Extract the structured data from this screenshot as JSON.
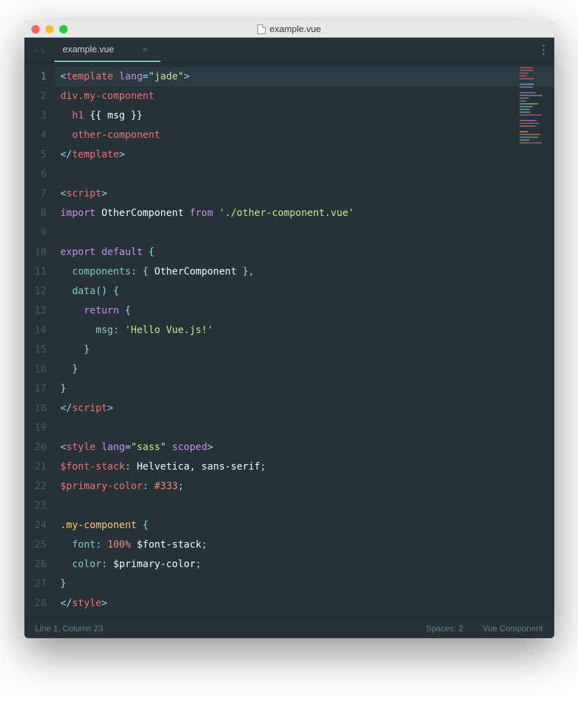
{
  "titlebar": {
    "filename": "example.vue"
  },
  "tabs": {
    "active": {
      "label": "example.vue"
    }
  },
  "gutter": {
    "lines": [
      "1",
      "2",
      "3",
      "4",
      "5",
      "6",
      "7",
      "8",
      "9",
      "10",
      "11",
      "12",
      "13",
      "14",
      "15",
      "16",
      "17",
      "18",
      "19",
      "20",
      "21",
      "22",
      "23",
      "24",
      "25",
      "26",
      "27",
      "28"
    ],
    "active_line": 1
  },
  "code": {
    "lines": [
      [
        {
          "t": "<",
          "c": "c-punct"
        },
        {
          "t": "template",
          "c": "c-tag"
        },
        {
          "t": " lang",
          "c": "c-attr"
        },
        {
          "t": "=",
          "c": "c-punct"
        },
        {
          "t": "\"jade\"",
          "c": "c-str"
        },
        {
          "t": ">",
          "c": "c-punct"
        }
      ],
      [
        {
          "t": "div.my-component",
          "c": "c-tag"
        }
      ],
      [
        {
          "t": "  h1",
          "c": "c-tag"
        },
        {
          "t": " {{ msg }}",
          "c": "c-plain"
        }
      ],
      [
        {
          "t": "  other-component",
          "c": "c-tag"
        }
      ],
      [
        {
          "t": "</",
          "c": "c-punct"
        },
        {
          "t": "template",
          "c": "c-tag"
        },
        {
          "t": ">",
          "c": "c-punct"
        }
      ],
      [],
      [
        {
          "t": "<",
          "c": "c-punct"
        },
        {
          "t": "script",
          "c": "c-tag"
        },
        {
          "t": ">",
          "c": "c-punct"
        }
      ],
      [
        {
          "t": "import",
          "c": "c-kw"
        },
        {
          "t": " OtherComponent ",
          "c": "c-plain"
        },
        {
          "t": "from",
          "c": "c-kw"
        },
        {
          "t": " './other-component.vue'",
          "c": "c-str"
        }
      ],
      [],
      [
        {
          "t": "export default",
          "c": "c-kw"
        },
        {
          "t": " {",
          "c": "c-punct"
        }
      ],
      [
        {
          "t": "  components",
          "c": "c-prop"
        },
        {
          "t": ":",
          "c": "c-punct"
        },
        {
          "t": " { ",
          "c": "c-punct"
        },
        {
          "t": "OtherComponent",
          "c": "c-plain"
        },
        {
          "t": " },",
          "c": "c-punct"
        }
      ],
      [
        {
          "t": "  data",
          "c": "c-prop"
        },
        {
          "t": "() {",
          "c": "c-punct"
        }
      ],
      [
        {
          "t": "    return",
          "c": "c-kw"
        },
        {
          "t": " {",
          "c": "c-punct"
        }
      ],
      [
        {
          "t": "      msg",
          "c": "c-prop"
        },
        {
          "t": ":",
          "c": "c-punct"
        },
        {
          "t": " 'Hello Vue.js!'",
          "c": "c-str"
        }
      ],
      [
        {
          "t": "    }",
          "c": "c-punct"
        }
      ],
      [
        {
          "t": "  }",
          "c": "c-punct"
        }
      ],
      [
        {
          "t": "}",
          "c": "c-punct"
        }
      ],
      [
        {
          "t": "</",
          "c": "c-punct"
        },
        {
          "t": "script",
          "c": "c-tag"
        },
        {
          "t": ">",
          "c": "c-punct"
        }
      ],
      [],
      [
        {
          "t": "<",
          "c": "c-punct"
        },
        {
          "t": "style",
          "c": "c-tag"
        },
        {
          "t": " lang",
          "c": "c-attr"
        },
        {
          "t": "=",
          "c": "c-punct"
        },
        {
          "t": "\"sass\"",
          "c": "c-str"
        },
        {
          "t": " scoped",
          "c": "c-attr"
        },
        {
          "t": ">",
          "c": "c-punct"
        }
      ],
      [
        {
          "t": "$font-stack",
          "c": "c-tag"
        },
        {
          "t": ":",
          "c": "c-punct"
        },
        {
          "t": " Helvetica, sans-serif",
          "c": "c-sass"
        },
        {
          "t": ";",
          "c": "c-punct"
        }
      ],
      [
        {
          "t": "$primary-color",
          "c": "c-tag"
        },
        {
          "t": ":",
          "c": "c-punct"
        },
        {
          "t": " #333",
          "c": "c-num"
        },
        {
          "t": ";",
          "c": "c-punct"
        }
      ],
      [],
      [
        {
          "t": ".my-component",
          "c": "c-sel"
        },
        {
          "t": " {",
          "c": "c-punct"
        }
      ],
      [
        {
          "t": "  font",
          "c": "c-prop"
        },
        {
          "t": ":",
          "c": "c-punct"
        },
        {
          "t": " 100%",
          "c": "c-num"
        },
        {
          "t": " $font-stack",
          "c": "c-sass"
        },
        {
          "t": ";",
          "c": "c-punct"
        }
      ],
      [
        {
          "t": "  color",
          "c": "c-prop"
        },
        {
          "t": ":",
          "c": "c-punct"
        },
        {
          "t": " $primary-color",
          "c": "c-sass"
        },
        {
          "t": ";",
          "c": "c-punct"
        }
      ],
      [
        {
          "t": "}",
          "c": "c-punct"
        }
      ],
      [
        {
          "t": "</",
          "c": "c-punct"
        },
        {
          "t": "style",
          "c": "c-tag"
        },
        {
          "t": ">",
          "c": "c-punct"
        }
      ]
    ]
  },
  "statusbar": {
    "position": "Line 1, Column 23",
    "spaces": "Spaces: 2",
    "filetype": "Vue Component"
  }
}
